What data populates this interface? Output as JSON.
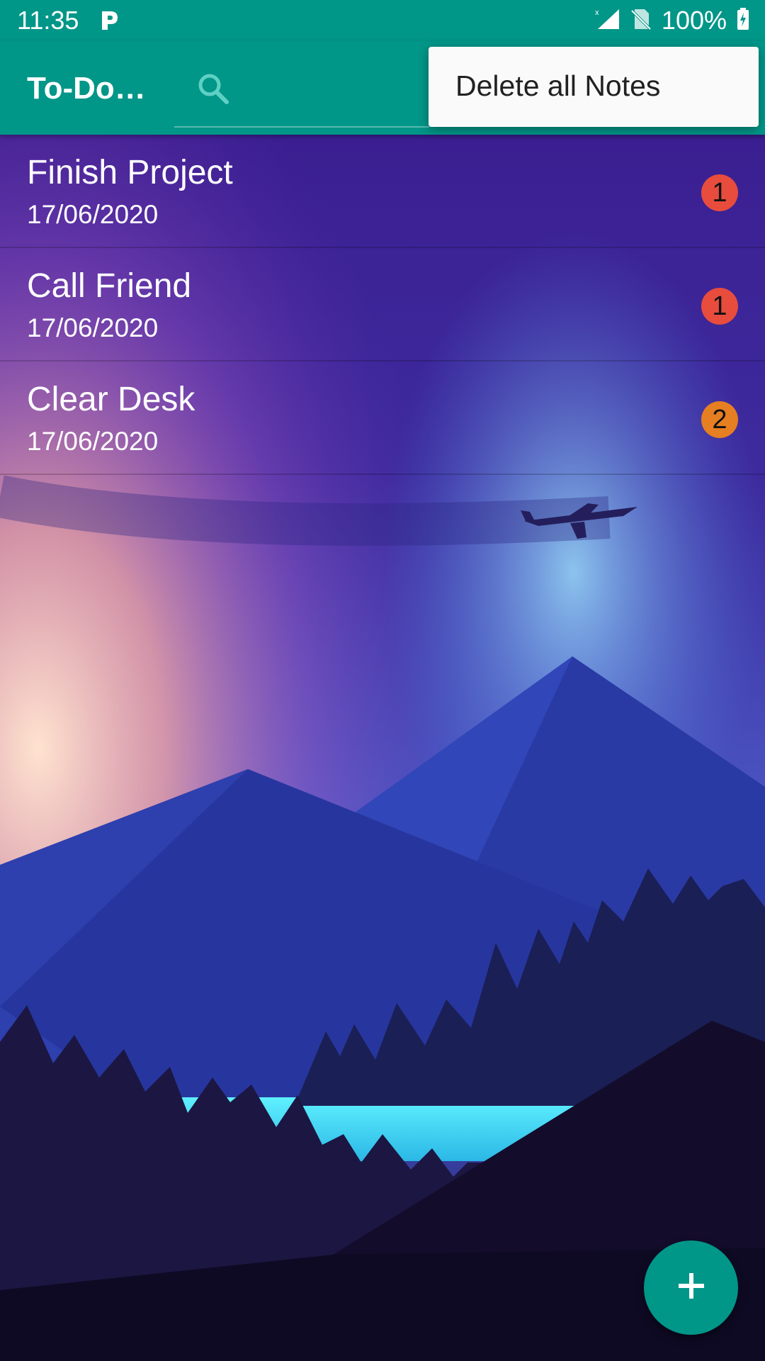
{
  "status_bar": {
    "time": "11:35",
    "notification_icon": "p-icon",
    "battery_text": "100%"
  },
  "app_bar": {
    "title": "To-Do…",
    "search_icon": "search-icon",
    "color": "#009688"
  },
  "overflow_menu": {
    "items": [
      {
        "label": "Delete all Notes"
      }
    ]
  },
  "notes": [
    {
      "title": "Finish Project",
      "date": "17/06/2020",
      "priority": "1",
      "priority_color": "#e74c3c"
    },
    {
      "title": "Call Friend",
      "date": "17/06/2020",
      "priority": "1",
      "priority_color": "#e74c3c"
    },
    {
      "title": "Clear Desk",
      "date": "17/06/2020",
      "priority": "2",
      "priority_color": "#e67e22"
    }
  ],
  "fab": {
    "icon": "plus-icon"
  }
}
